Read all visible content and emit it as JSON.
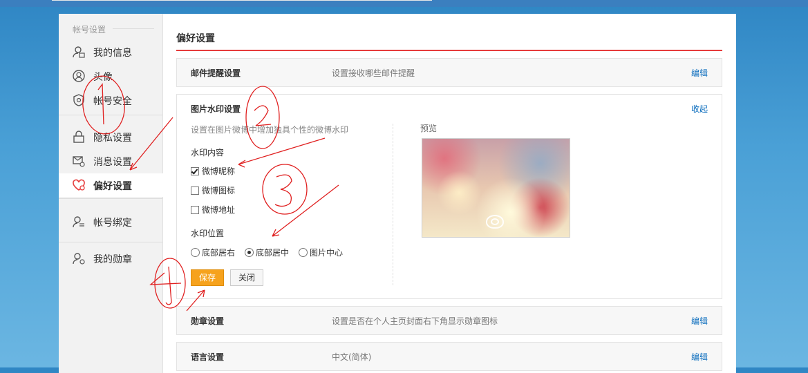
{
  "sidebar": {
    "group_title": "帐号设置",
    "items": [
      {
        "label": "我的信息",
        "icon": "user-info-icon"
      },
      {
        "label": "头像",
        "icon": "avatar-icon"
      },
      {
        "label": "帐号安全",
        "icon": "shield-icon"
      },
      {
        "label": "隐私设置",
        "icon": "lock-icon"
      },
      {
        "label": "消息设置",
        "icon": "message-gear-icon"
      },
      {
        "label": "偏好设置",
        "icon": "heart-gear-icon",
        "active": true
      },
      {
        "label": "帐号绑定",
        "icon": "user-link-icon"
      },
      {
        "label": "我的勋章",
        "icon": "user-medal-icon"
      }
    ]
  },
  "main": {
    "title": "偏好设置",
    "mail_setting": {
      "title": "邮件提醒设置",
      "desc": "设置接收哪些邮件提醒",
      "action": "编辑"
    },
    "watermark": {
      "title": "图片水印设置",
      "collapse": "收起",
      "desc": "设置在图片微博中增加独具个性的微博水印",
      "content_label": "水印内容",
      "options": [
        {
          "label": "微博昵称",
          "checked": true
        },
        {
          "label": "微博图标",
          "checked": false
        },
        {
          "label": "微博地址",
          "checked": false
        }
      ],
      "position_label": "水印位置",
      "positions": [
        {
          "label": "底部居右",
          "selected": false
        },
        {
          "label": "底部居中",
          "selected": true
        },
        {
          "label": "图片中心",
          "selected": false
        }
      ],
      "save": "保存",
      "close": "关闭",
      "preview_label": "预览"
    },
    "medal_setting": {
      "title": "勋章设置",
      "desc": "设置是否在个人主页封面右下角显示勋章图标",
      "action": "编辑"
    },
    "language_setting": {
      "title": "语言设置",
      "desc": "中文(简体)",
      "action": "编辑"
    }
  },
  "colors": {
    "accent_red": "#e63b3b",
    "link_blue": "#0a6cbd",
    "save_orange": "#f6a21d",
    "annotation_red": "#e02020"
  }
}
